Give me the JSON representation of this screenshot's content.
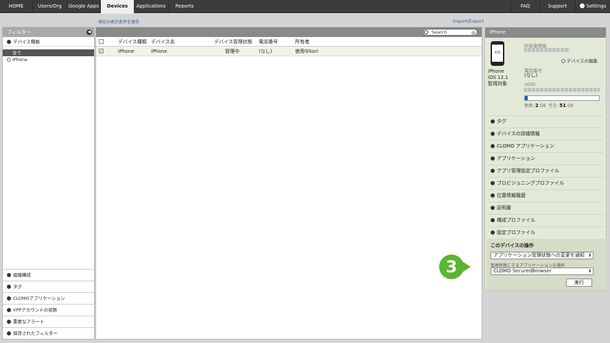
{
  "nav": {
    "tabs": [
      "HOME",
      "Users/Org",
      "Google Apps",
      "Devices",
      "Applications",
      "Reports"
    ],
    "active": "Devices",
    "faq": "FAQ",
    "support": "Support",
    "settings": "Settings"
  },
  "toolbar": {
    "save_view": "現在の表示条件を保存",
    "import_export": "Import/Export"
  },
  "filter": {
    "title": "フィルター",
    "device_type": "デバイス種類",
    "all": "全て",
    "iphone": "iPhone",
    "bottom": [
      "組織構成",
      "タグ",
      "CLOMOアプリケーション",
      "VPPアカウントの状態",
      "重要なアラート",
      "保存されたフィルター"
    ]
  },
  "search": {
    "placeholder": "Search"
  },
  "table": {
    "headers": [
      "デバイス種類",
      "デバイス名",
      "デバイス管理状態",
      "電話番号",
      "所有者"
    ],
    "rows": [
      {
        "type": "iPhone",
        "name": "iPhone",
        "state": "管理中",
        "phone": "(なし)",
        "owner": "使用中kori"
      }
    ]
  },
  "detail": {
    "title": "iPhone",
    "icon_text": "iOS",
    "device_name": "iPhone",
    "os": "iOS 12.1",
    "supervised": "監視対象",
    "owner_label": "所有者情報",
    "edit": "デバイスの編集",
    "phone_label": "電話番号",
    "phone_value": "(なし)",
    "udid_label": "UDID",
    "used_label": "使用:",
    "used_value": "2",
    "free_label": "空き:",
    "free_value": "51",
    "unit": "GB",
    "storage_used_fraction": 0.04,
    "accordions": [
      "タグ",
      "デバイスの詳細情報",
      "CLOMO アプリケーション",
      "アプリケーション",
      "アプリ管理設定プロファイル",
      "プロビジョニングプロファイル",
      "位置情報履歴",
      "証明書",
      "構成プロファイル",
      "設定プロファイル"
    ]
  },
  "ops": {
    "title": "このデバイスの操作",
    "action": "アプリケーション管理状態への変更を通知",
    "select_label": "管理状態にするアプリケーションを選択",
    "app": "CLOMO SecuredBrowser",
    "run": "実行"
  },
  "callout": {
    "number": "3",
    "color": "#5cb531"
  }
}
